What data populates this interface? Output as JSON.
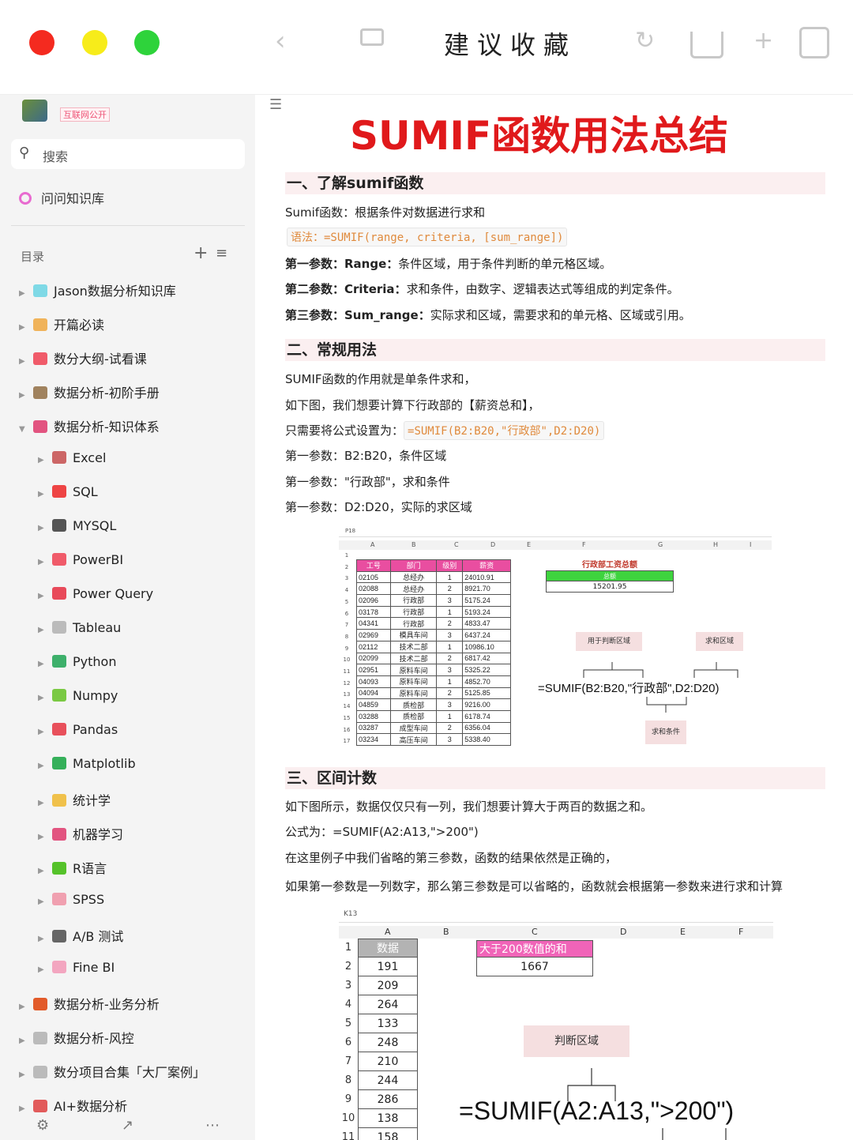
{
  "window": {
    "title": "建议收藏",
    "traffic_colors": [
      "#f42a1f",
      "#f7ec1a",
      "#2ed33b"
    ],
    "icons": [
      "chevron-left-icon",
      "sidebar-toggle-icon",
      "refresh-icon",
      "share-icon",
      "plus-icon",
      "copy-icon"
    ]
  },
  "sidebar": {
    "brand_tag": "互联网公开",
    "search_placeholder": "搜索",
    "kb_label": "问问知识库",
    "toc_label": "目录",
    "items": [
      {
        "label": "Jason数据分析知识库",
        "level": 0,
        "icon": "folder-icon",
        "color": "#7fd9e6"
      },
      {
        "label": "开篇必读",
        "level": 0,
        "icon": "pencil-note-icon",
        "color": "#f0b35a"
      },
      {
        "label": "数分大纲-试看课",
        "level": 0,
        "icon": "gem-icon",
        "color": "#f05b6a"
      },
      {
        "label": "数据分析-初阶手册",
        "level": 0,
        "icon": "hourglass-icon",
        "color": "#a0825e"
      },
      {
        "label": "数据分析-知识体系",
        "level": 0,
        "icon": "music-note-icon",
        "color": "#e25480",
        "expanded": true
      },
      {
        "label": "Excel",
        "level": 1,
        "icon": "excel-icon",
        "color": "#c66"
      },
      {
        "label": "SQL",
        "level": 1,
        "icon": "cherries-icon",
        "color": "#e44"
      },
      {
        "label": "MYSQL",
        "level": 1,
        "icon": "bomb-icon",
        "color": "#555"
      },
      {
        "label": "PowerBI",
        "level": 1,
        "icon": "gem-icon",
        "color": "#f05b6a"
      },
      {
        "label": "Power Query",
        "level": 1,
        "icon": "target-icon",
        "color": "#e84a5a"
      },
      {
        "label": "Tableau",
        "level": 1,
        "icon": "link-icon",
        "color": "#bbb"
      },
      {
        "label": "Python",
        "level": 1,
        "icon": "python-icon",
        "color": "#3db06b"
      },
      {
        "label": "Numpy",
        "level": 1,
        "icon": "brush-icon",
        "color": "#7ac943"
      },
      {
        "label": "Pandas",
        "level": 1,
        "icon": "plane-icon",
        "color": "#e8505b"
      },
      {
        "label": "Matplotlib",
        "level": 1,
        "icon": "chart-icon",
        "color": "#35b05a"
      },
      {
        "label": "统计学",
        "level": 1,
        "icon": "note-icon",
        "color": "#f0c14b"
      },
      {
        "label": "机器学习",
        "level": 1,
        "icon": "robot-icon",
        "color": "#e25480"
      },
      {
        "label": "R语言",
        "level": 1,
        "icon": "square-icon",
        "color": "#55c22a"
      },
      {
        "label": "SPSS",
        "level": 1,
        "icon": "feather-icon",
        "color": "#f0a0b0"
      },
      {
        "label": "A/B 测试",
        "level": 1,
        "icon": "tag-icon",
        "color": "#666"
      },
      {
        "label": "Fine BI",
        "level": 1,
        "icon": "globe-icon",
        "color": "#f3a6c0"
      },
      {
        "label": "数据分析-业务分析",
        "level": 0,
        "icon": "medal-icon",
        "color": "#e25b2a"
      },
      {
        "label": "数据分析-风控",
        "level": 0,
        "icon": "bar-chart-icon",
        "color": "#bbb"
      },
      {
        "label": "数分项目合集「大厂案例」",
        "level": 0,
        "icon": "link-icon",
        "color": "#bbb"
      },
      {
        "label": "AI+数据分析",
        "level": 0,
        "icon": "satellite-icon",
        "color": "#e25b5b"
      }
    ],
    "bottom_icons": [
      "settings-icon",
      "share-icon",
      "more-icon"
    ]
  },
  "doc": {
    "title": "SUMIF函数用法总结",
    "s1": {
      "heading": "一、了解sumif函数",
      "intro": "Sumif函数：根据条件对数据进行求和",
      "syntax": "语法：=SUMIF(range, criteria, [sum_range])",
      "p1_bold": "第一参数：Range：",
      "p1_text": "条件区域，用于条件判断的单元格区域。",
      "p2_bold": "第二参数：Criteria：",
      "p2_text": "求和条件，由数字、逻辑表达式等组成的判定条件。",
      "p3_bold": "第三参数：Sum_range：",
      "p3_text": "实际求和区域，需要求和的单元格、区域或引用。"
    },
    "s2": {
      "heading": "二、常规用法",
      "l1": "SUMIF函数的作用就是单条件求和，",
      "l2": "如下图，我们想要计算下行政部的【薪资总和】，",
      "l3_prefix": "只需要将公式设置为：",
      "l3_code": "=SUMIF(B2:B20,\"行政部\",D2:D20)",
      "l4": "第一参数：B2:B20，条件区域",
      "l5": "第一参数：\"行政部\"，求和条件",
      "l6": "第一参数：D2:D20，实际的求区域"
    },
    "sheet1": {
      "cell_ref": "P18",
      "cols": [
        "A",
        "B",
        "C",
        "D",
        "E",
        "F",
        "G",
        "H",
        "I"
      ],
      "headers": [
        "工号",
        "部门",
        "级别",
        "薪资"
      ],
      "rows": [
        [
          "02105",
          "总经办",
          "1",
          "24010.91"
        ],
        [
          "02088",
          "总经办",
          "2",
          "8921.70"
        ],
        [
          "02096",
          "行政部",
          "3",
          "5175.24"
        ],
        [
          "03178",
          "行政部",
          "1",
          "5193.24"
        ],
        [
          "04341",
          "行政部",
          "2",
          "4833.47"
        ],
        [
          "02969",
          "模具车间",
          "3",
          "6437.24"
        ],
        [
          "02112",
          "技术二部",
          "1",
          "10986.10"
        ],
        [
          "02099",
          "技术二部",
          "2",
          "6817.42"
        ],
        [
          "02951",
          "原料车间",
          "3",
          "5325.22"
        ],
        [
          "04093",
          "原料车间",
          "1",
          "4852.70"
        ],
        [
          "04094",
          "原料车间",
          "2",
          "5125.85"
        ],
        [
          "04859",
          "质检部",
          "3",
          "9216.00"
        ],
        [
          "03288",
          "质检部",
          "1",
          "6178.74"
        ],
        [
          "03287",
          "成型车间",
          "2",
          "6356.04"
        ],
        [
          "03234",
          "高压车间",
          "3",
          "5338.40"
        ]
      ],
      "summary_title": "行政部工资总额",
      "summary_header": "总额",
      "summary_value": "15201.95",
      "note_range": "用于判断区域",
      "note_sum": "求和区域",
      "note_criteria": "求和条件",
      "formula": "=SUMIF(B2:B20,\"行政部\",D2:D20)"
    },
    "s3": {
      "heading": "三、区间计数",
      "l1": "如下图所示，数据仅仅只有一列，我们想要计算大于两百的数据之和。",
      "l2": "公式为：=SUMIF(A2:A13,\">200\")",
      "l3": "在这里例子中我们省略的第三参数，函数的结果依然是正确的，",
      "l4": "如果第一参数是一列数字，那么第三参数是可以省略的，函数就会根据第一参数来进行求和计算"
    },
    "sheet2": {
      "cell_ref": "K13",
      "cols": [
        "A",
        "B",
        "C",
        "D",
        "E",
        "F"
      ],
      "header": "数据",
      "values": [
        "191",
        "209",
        "264",
        "133",
        "248",
        "210",
        "244",
        "286",
        "138",
        "158"
      ],
      "result_title": "大于200数值的和",
      "result_value": "1667",
      "note": "判断区域",
      "formula": "=SUMIF(A2:A13,\">200\")"
    }
  }
}
